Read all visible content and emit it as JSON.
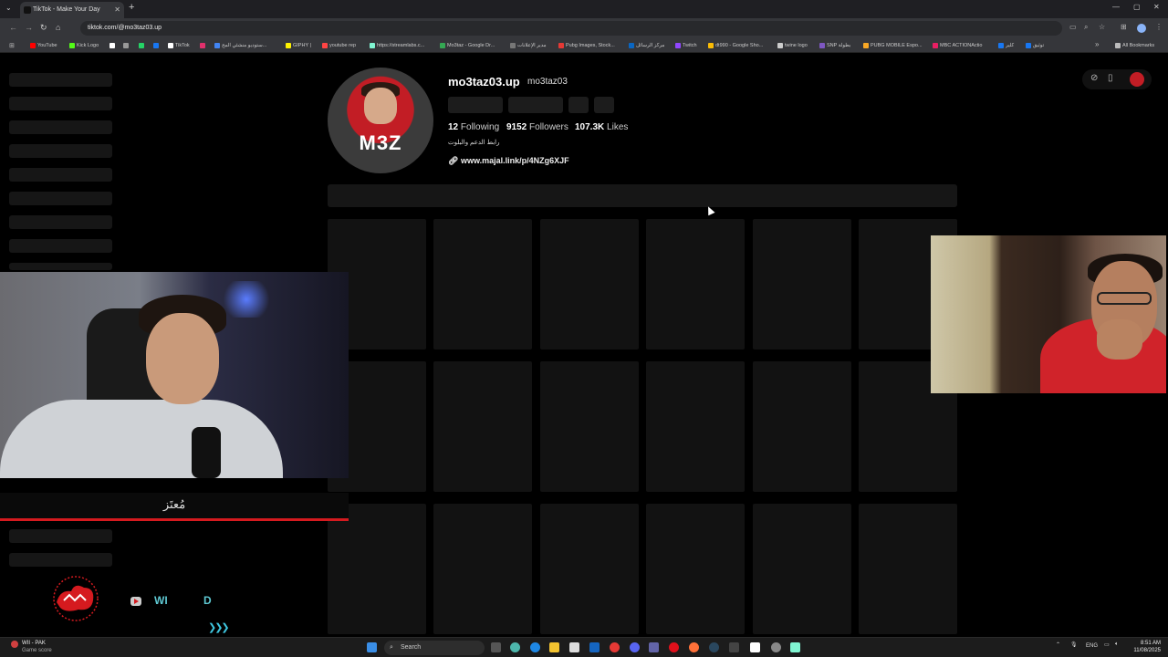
{
  "browser": {
    "tab_title": "TikTok - Make Your Day",
    "url": "tiktok.com/@mo3taz03.up",
    "bookmarks": [
      {
        "label": "YouTube",
        "color": "#ff0000"
      },
      {
        "label": "Kick Logo",
        "color": "#53fc18"
      },
      {
        "label": "",
        "color": "#ffffff"
      },
      {
        "label": "",
        "color": "#25d366"
      },
      {
        "label": "",
        "color": "#1877f2"
      },
      {
        "label": "TikTok",
        "color": "#ffffff"
      },
      {
        "label": "",
        "color": "#e1306c"
      },
      {
        "label": "ستوديو منشئي المح...",
        "color": "#4285f4"
      },
      {
        "label": "GIPHY |",
        "color": "#fff200"
      },
      {
        "label": "youtube rep",
        "color": "#ff4444"
      },
      {
        "label": "https://streamlabs.c...",
        "color": "#80f5d2"
      },
      {
        "label": "Mo3taz - Google Dr...",
        "color": "#34a853"
      },
      {
        "label": "مدير الإعلانات",
        "color": "#777777"
      },
      {
        "label": "Pubg Images, Stock...",
        "color": "#e53935"
      },
      {
        "label": "مركز الرسائل",
        "color": "#0a66c2"
      },
      {
        "label": "Twitch",
        "color": "#9146ff"
      },
      {
        "label": "dt990 - Google Sho...",
        "color": "#fbbc05"
      },
      {
        "label": "twine logo",
        "color": "#cccccc"
      },
      {
        "label": "SNP بطولة",
        "color": "#7e57c2"
      },
      {
        "label": "PUBG MOBILE Espo...",
        "color": "#f9a825"
      },
      {
        "label": "MBC ACTIONActio",
        "color": "#e91e63"
      },
      {
        "label": "كلير",
        "color": "#1877f2"
      },
      {
        "label": "توثيق",
        "color": "#1877f2"
      }
    ],
    "all_bookmarks": "All Bookmarks"
  },
  "profile": {
    "username": "mo3taz03.up",
    "handle": "mo3taz03",
    "avatar_logo": "M3Z",
    "following_count": "12",
    "following_label": "Following",
    "followers_count": "9152",
    "followers_label": "Followers",
    "likes_count": "107.3K",
    "likes_label": "Likes",
    "bio": "رابط الدعم والبلوت",
    "link": "www.majal.link/p/4NZg6XJF"
  },
  "overlay": {
    "name_signature": "مُعتَز",
    "wi_text": "WI",
    "d_text": "D",
    "arrows": "❯❯❯"
  },
  "taskbar": {
    "game_title": "WII - PAK",
    "game_subtitle": "Game score",
    "search_label": "Search",
    "language": "ENG",
    "time": "8:51 AM",
    "date": "11/08/2025"
  }
}
